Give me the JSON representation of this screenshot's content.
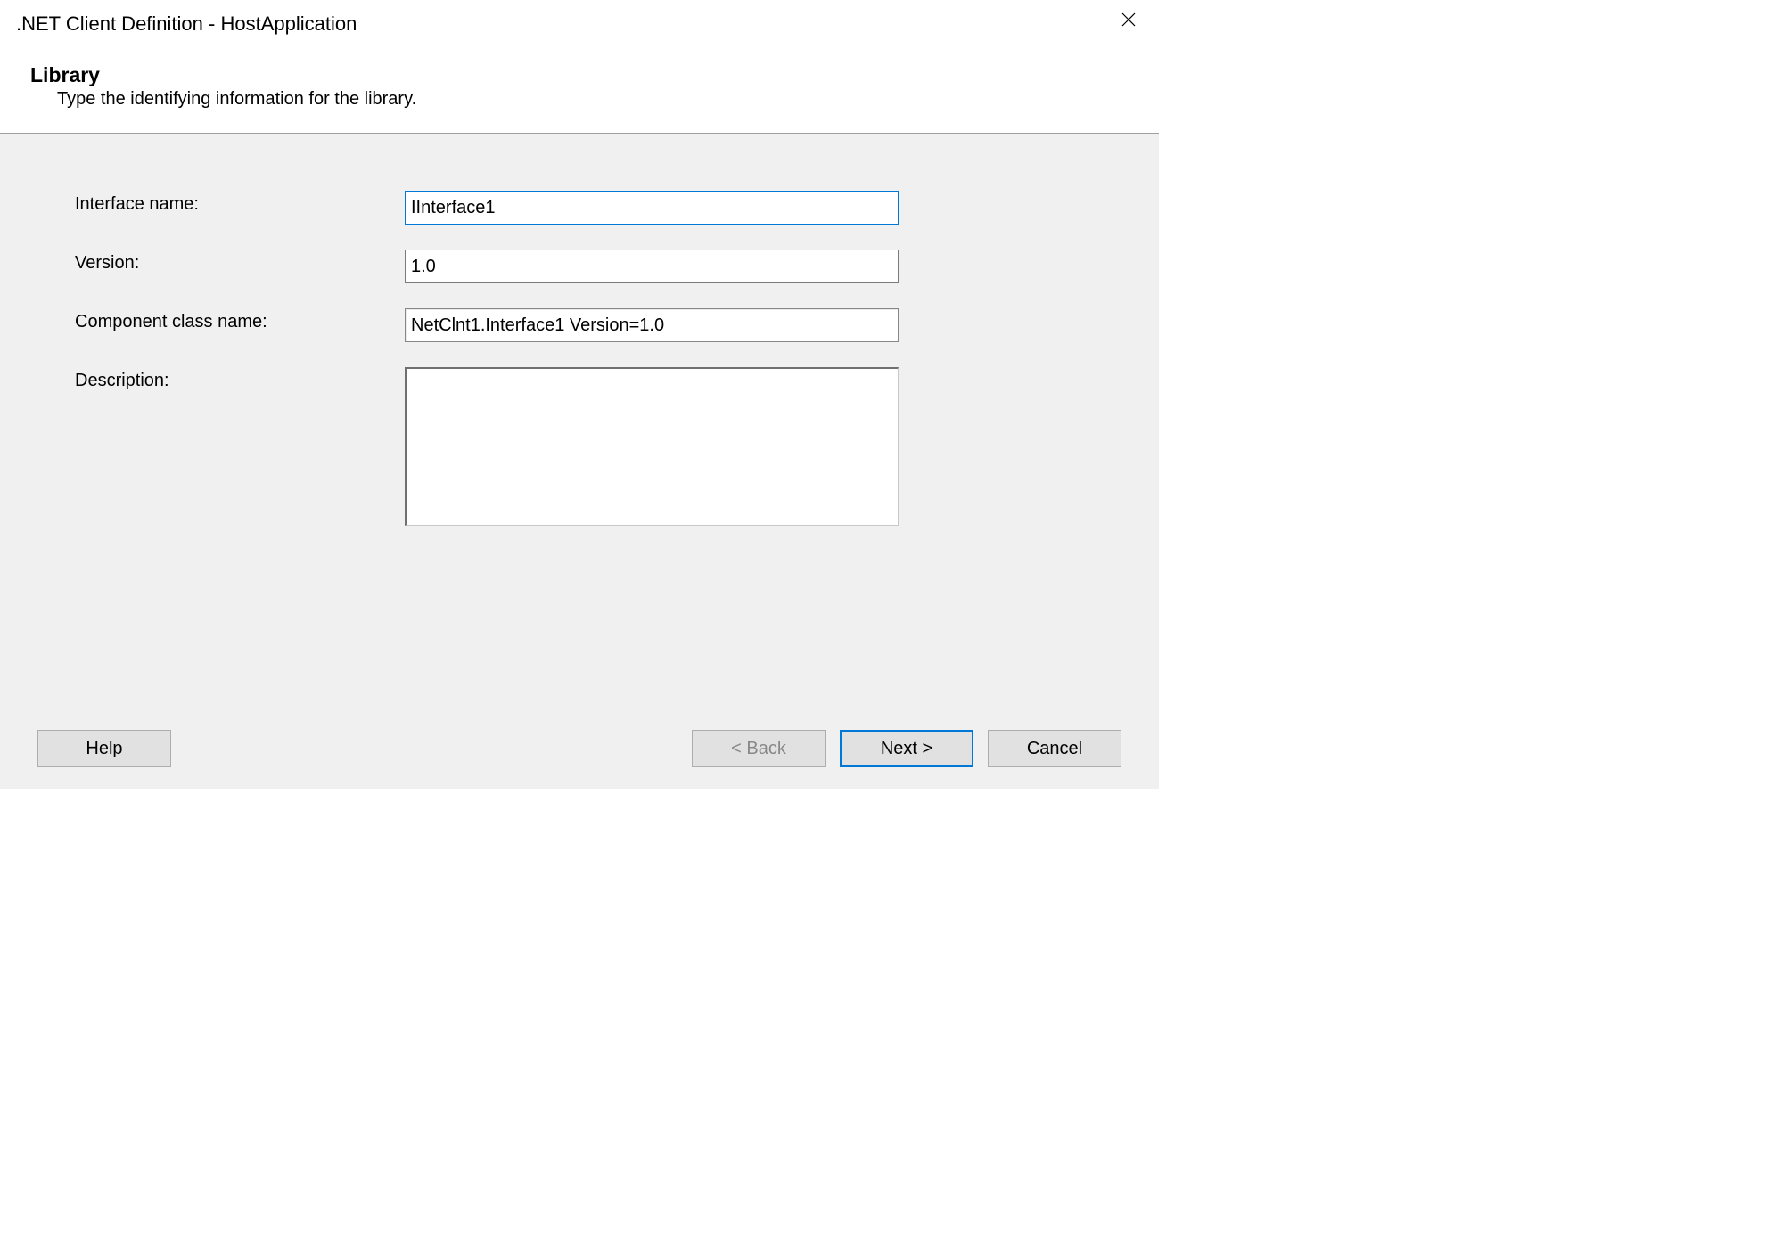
{
  "window": {
    "title": ".NET Client Definition - HostApplication"
  },
  "header": {
    "title": "Library",
    "subtitle": "Type the identifying information for the library."
  },
  "form": {
    "interface_name": {
      "label": "Interface name:",
      "value": "IInterface1"
    },
    "version": {
      "label": "Version:",
      "value": "1.0"
    },
    "component_class_name": {
      "label": "Component class name:",
      "value": "NetClnt1.Interface1 Version=1.0"
    },
    "description": {
      "label": "Description:",
      "value": ""
    }
  },
  "buttons": {
    "help": "Help",
    "back": "< Back",
    "next": "Next >",
    "cancel": "Cancel"
  }
}
